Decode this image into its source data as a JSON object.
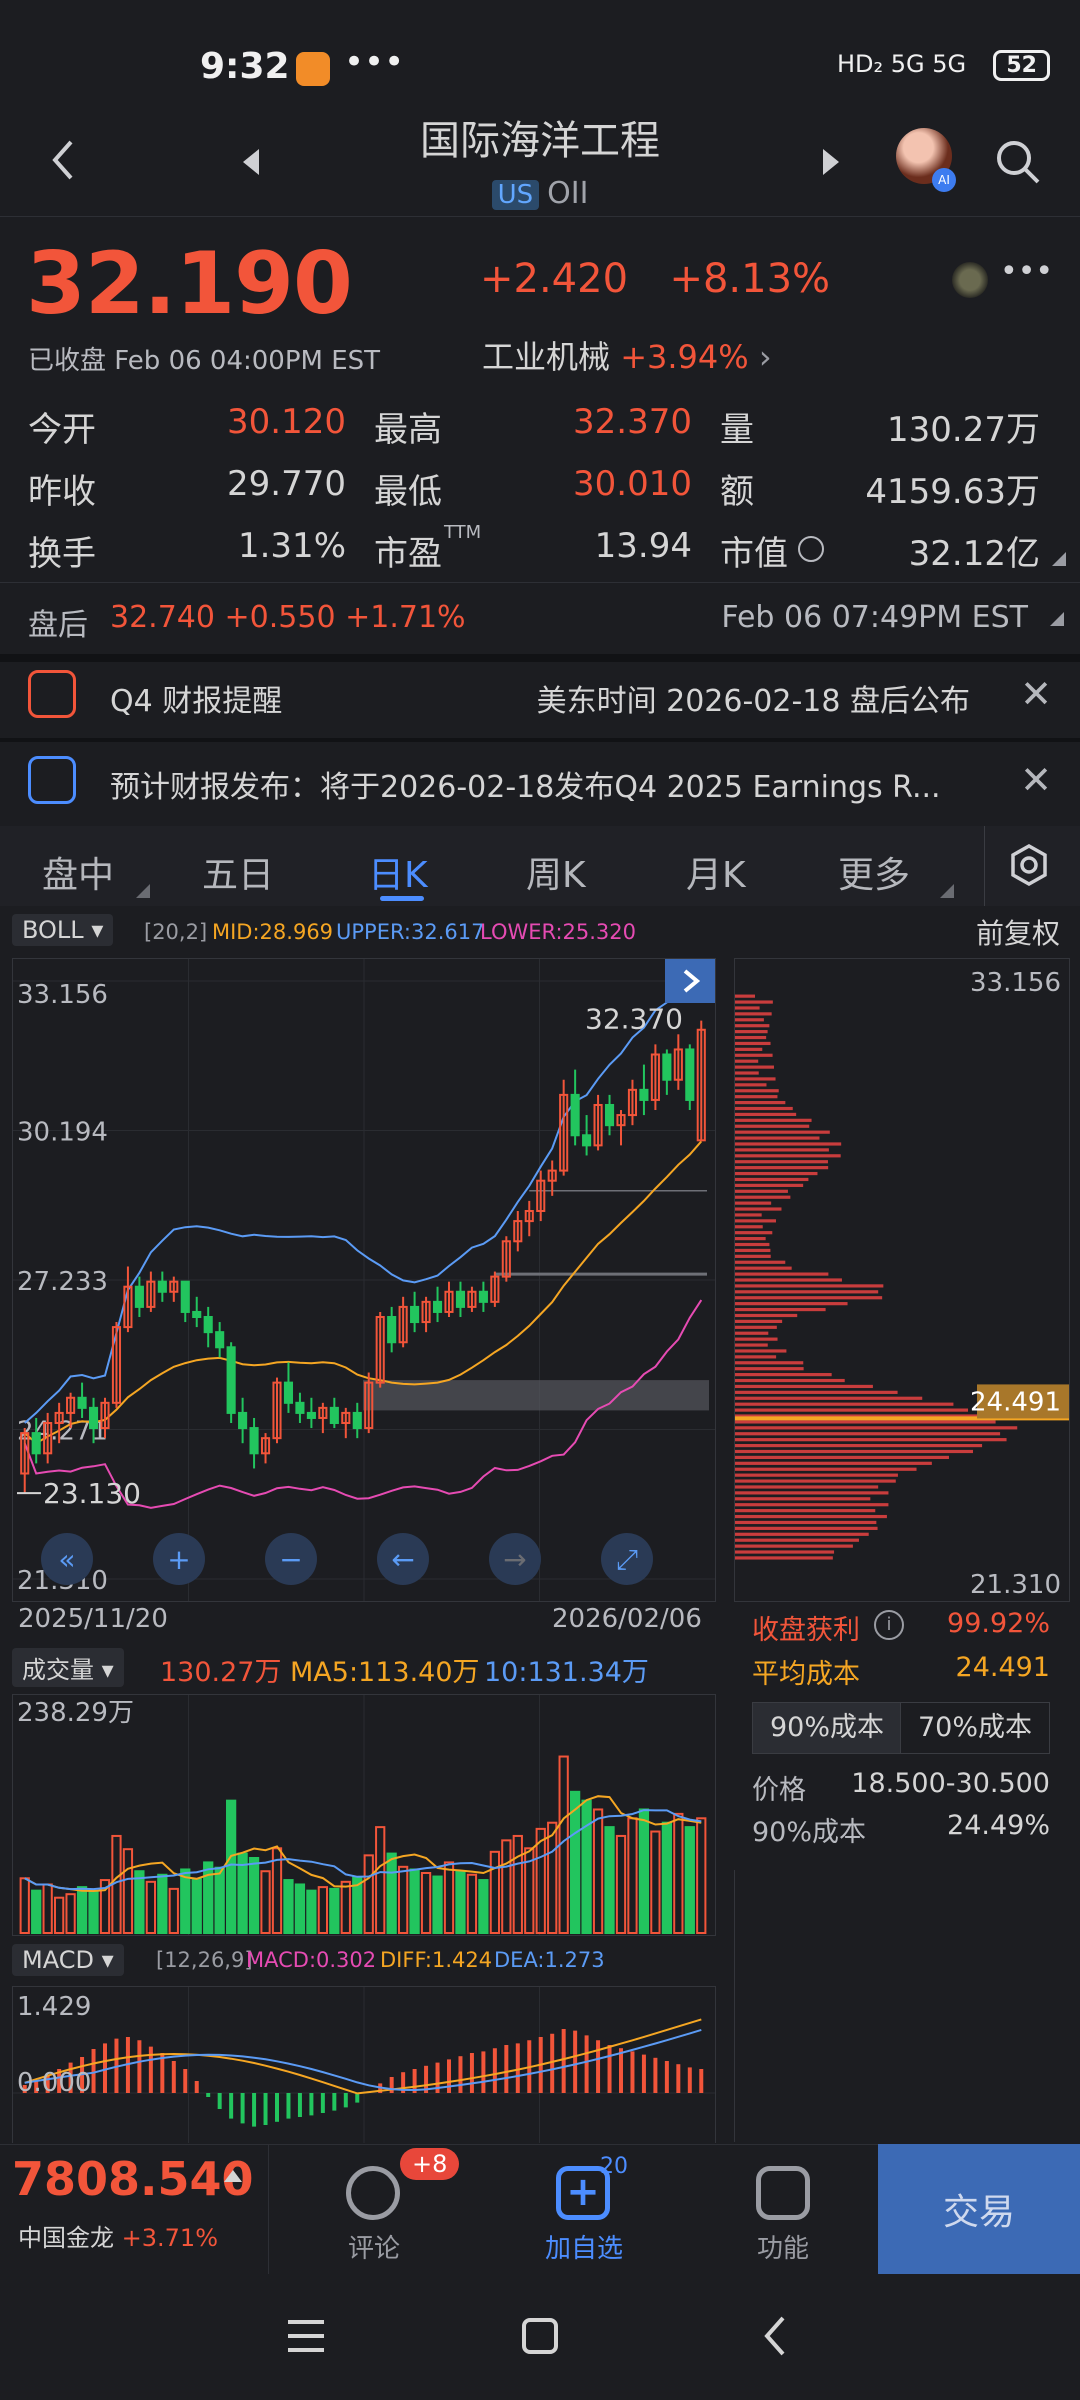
{
  "status": {
    "time": "9:32",
    "battery": "52",
    "network": "HD₂ 5G 5G"
  },
  "header": {
    "title": "国际海洋工程",
    "market_badge": "US",
    "ticker": "OII"
  },
  "quote": {
    "price": "32.190",
    "change": "+2.420",
    "change_pct": "+8.13%",
    "status": "已收盘 Feb 06 04:00PM EST",
    "industry": "工业机械",
    "industry_pct": "+3.94%",
    "stats": [
      {
        "label": "今开",
        "value": "30.120",
        "color": "#f2553a"
      },
      {
        "label": "最高",
        "value": "32.370",
        "color": "#f2553a"
      },
      {
        "label": "量",
        "value": "130.27万",
        "color": "#d5d5d5"
      },
      {
        "label": "昨收",
        "value": "29.770",
        "color": "#d5d5d5"
      },
      {
        "label": "最低",
        "value": "30.010",
        "color": "#f2553a"
      },
      {
        "label": "额",
        "value": "4159.63万",
        "color": "#d5d5d5"
      },
      {
        "label": "换手",
        "value": "1.31%",
        "color": "#d5d5d5"
      },
      {
        "label": "市盈",
        "value": "13.94",
        "color": "#d5d5d5"
      },
      {
        "label": "市值",
        "value": "32.12亿",
        "color": "#d5d5d5"
      }
    ],
    "ttm": "TTM"
  },
  "after_hours": {
    "label": "盘后",
    "price": "32.740",
    "change": "+0.550",
    "pct": "+1.71%",
    "time": "Feb 06 07:49PM EST"
  },
  "banners": [
    {
      "left": "Q4 财报提醒",
      "right": "美东时间 2026-02-18 盘后公布"
    },
    {
      "left": "预计财报发布：将于2026-02-18发布Q4 2025 Earnings R...",
      "right": ""
    }
  ],
  "tabs": [
    "盘中",
    "五日",
    "日K",
    "周K",
    "月K",
    "更多"
  ],
  "active_tab": "日K",
  "chart": {
    "indicator": "BOLL",
    "params": "[20,2]",
    "mid": "MID:28.969",
    "upper": "UPPER:32.617",
    "lower": "LOWER:25.320",
    "adjust": "前复权",
    "y_labels": [
      "33.156",
      "30.194",
      "27.233",
      "24.271",
      "21.310"
    ],
    "high_mark": "32.370",
    "low_mark": "23.130",
    "date_start": "2025/11/20",
    "date_end": "2026/02/06",
    "vp_top": "33.156",
    "vp_bottom": "21.310",
    "vp_cost": "24.491"
  },
  "cost": {
    "profit_label": "收盘获利",
    "profit_val": "99.92%",
    "avg_label": "平均成本",
    "avg_val": "24.491",
    "tab90": "90%成本",
    "tab70": "70%成本",
    "price_label": "价格",
    "price_val": "18.500-30.500",
    "c90_label": "90%成本",
    "c90_val": "24.49%"
  },
  "volume": {
    "label": "成交量",
    "vol": "130.27万",
    "ma5": "MA5:113.40万",
    "ma10": "10:131.34万",
    "max": "238.29万"
  },
  "macd": {
    "label": "MACD",
    "params": "[12,26,9]",
    "macd": "MACD:0.302",
    "diff": "DIFF:1.424",
    "dea": "DEA:1.273",
    "top": "1.429",
    "zero": "0.000"
  },
  "bottom": {
    "index_price": "7808.540",
    "index_name": "中国金龙",
    "index_pct": "+3.71%",
    "comment": "评论",
    "comment_badge": "+8",
    "watch": "加自选",
    "watch_badge": "20",
    "func": "功能",
    "trade": "交易"
  },
  "candles": [
    [
      23.4,
      24.3,
      23.0,
      24.2
    ],
    [
      24.2,
      24.5,
      23.6,
      23.8
    ],
    [
      23.8,
      24.6,
      23.6,
      24.4
    ],
    [
      24.4,
      24.8,
      24.0,
      24.6
    ],
    [
      24.6,
      25.0,
      24.3,
      24.9
    ],
    [
      24.9,
      25.2,
      24.5,
      24.7
    ],
    [
      24.7,
      24.9,
      24.0,
      24.3
    ],
    [
      24.3,
      24.9,
      24.1,
      24.8
    ],
    [
      24.8,
      26.4,
      24.7,
      26.3
    ],
    [
      26.3,
      27.5,
      26.2,
      27.1
    ],
    [
      27.1,
      27.3,
      26.5,
      26.7
    ],
    [
      26.7,
      27.4,
      26.6,
      27.2
    ],
    [
      27.2,
      27.4,
      26.8,
      27.0
    ],
    [
      27.0,
      27.3,
      26.8,
      27.2
    ],
    [
      27.2,
      27.2,
      26.4,
      26.6
    ],
    [
      26.6,
      26.9,
      26.3,
      26.5
    ],
    [
      26.5,
      26.7,
      25.9,
      26.2
    ],
    [
      26.2,
      26.4,
      25.7,
      25.9
    ],
    [
      25.9,
      26.0,
      24.4,
      24.6
    ],
    [
      24.6,
      24.9,
      24.0,
      24.3
    ],
    [
      24.3,
      24.5,
      23.5,
      23.8
    ],
    [
      23.8,
      24.2,
      23.6,
      24.1
    ],
    [
      24.1,
      25.3,
      24.0,
      25.2
    ],
    [
      25.2,
      25.6,
      24.6,
      24.8
    ],
    [
      24.8,
      25.0,
      24.4,
      24.6
    ],
    [
      24.6,
      24.9,
      24.3,
      24.5
    ],
    [
      24.5,
      24.8,
      24.2,
      24.7
    ],
    [
      24.7,
      24.9,
      24.3,
      24.4
    ],
    [
      24.4,
      24.7,
      24.1,
      24.6
    ],
    [
      24.6,
      24.8,
      24.1,
      24.3
    ],
    [
      24.3,
      25.4,
      24.2,
      25.2
    ],
    [
      25.2,
      26.6,
      25.1,
      26.5
    ],
    [
      26.5,
      26.7,
      25.8,
      26.0
    ],
    [
      26.0,
      26.9,
      25.9,
      26.7
    ],
    [
      26.7,
      27.0,
      26.2,
      26.4
    ],
    [
      26.4,
      26.9,
      26.2,
      26.8
    ],
    [
      26.8,
      27.1,
      26.4,
      26.6
    ],
    [
      26.6,
      27.2,
      26.5,
      27.0
    ],
    [
      27.0,
      27.2,
      26.5,
      26.7
    ],
    [
      26.7,
      27.1,
      26.6,
      27.0
    ],
    [
      27.0,
      27.2,
      26.6,
      26.8
    ],
    [
      26.8,
      27.4,
      26.7,
      27.3
    ],
    [
      27.3,
      28.1,
      27.2,
      28.0
    ],
    [
      28.0,
      28.6,
      27.8,
      28.4
    ],
    [
      28.4,
      28.8,
      28.1,
      28.6
    ],
    [
      28.6,
      29.4,
      28.4,
      29.2
    ],
    [
      29.2,
      29.6,
      28.9,
      29.4
    ],
    [
      29.4,
      31.2,
      29.3,
      30.9
    ],
    [
      30.9,
      31.4,
      29.9,
      30.1
    ],
    [
      30.1,
      30.5,
      29.7,
      29.9
    ],
    [
      29.9,
      30.9,
      29.8,
      30.7
    ],
    [
      30.7,
      30.9,
      30.1,
      30.3
    ],
    [
      30.3,
      30.6,
      29.9,
      30.5
    ],
    [
      30.5,
      31.2,
      30.3,
      31.0
    ],
    [
      31.0,
      31.5,
      30.5,
      30.8
    ],
    [
      30.8,
      31.9,
      30.6,
      31.7
    ],
    [
      31.7,
      31.8,
      30.9,
      31.2
    ],
    [
      31.2,
      32.1,
      31.0,
      31.8
    ],
    [
      31.8,
      31.9,
      30.6,
      30.8
    ],
    [
      30.0,
      32.37,
      30.01,
      32.19
    ]
  ],
  "volumes": [
    62,
    48,
    55,
    40,
    44,
    52,
    47,
    60,
    110,
    95,
    70,
    58,
    66,
    50,
    72,
    61,
    80,
    74,
    150,
    90,
    85,
    70,
    96,
    60,
    55,
    48,
    52,
    50,
    58,
    63,
    88,
    120,
    90,
    75,
    72,
    68,
    64,
    80,
    70,
    66,
    60,
    92,
    105,
    110,
    96,
    118,
    125,
    200,
    160,
    150,
    140,
    120,
    110,
    130,
    140,
    115,
    125,
    135,
    120,
    130
  ],
  "macd_bars": [
    0.1,
    0.15,
    0.22,
    0.3,
    0.38,
    0.45,
    0.55,
    0.62,
    0.68,
    0.7,
    0.66,
    0.58,
    0.5,
    0.4,
    0.3,
    0.15,
    -0.05,
    -0.2,
    -0.32,
    -0.38,
    -0.42,
    -0.4,
    -0.36,
    -0.32,
    -0.3,
    -0.28,
    -0.25,
    -0.22,
    -0.18,
    -0.12,
    0.02,
    0.12,
    0.2,
    0.26,
    0.3,
    0.34,
    0.38,
    0.42,
    0.46,
    0.5,
    0.52,
    0.56,
    0.6,
    0.62,
    0.66,
    0.7,
    0.74,
    0.8,
    0.78,
    0.72,
    0.66,
    0.6,
    0.56,
    0.52,
    0.48,
    0.44,
    0.4,
    0.36,
    0.32,
    0.3
  ]
}
